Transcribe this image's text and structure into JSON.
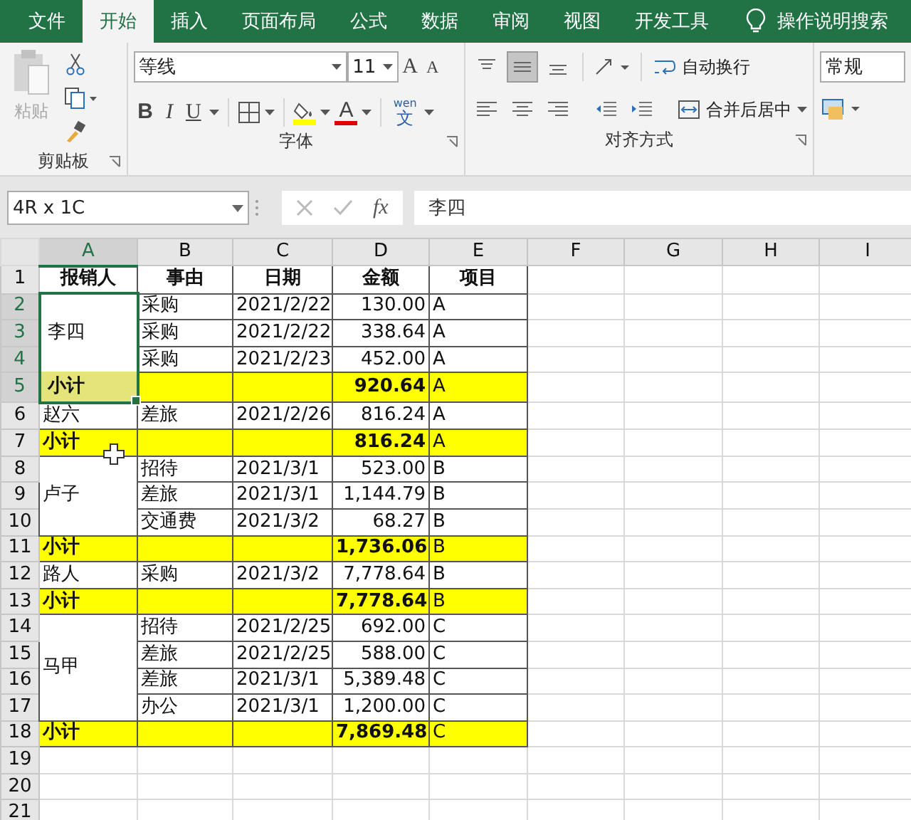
{
  "ribbon_tabs": [
    {
      "label": "文件",
      "selected": false
    },
    {
      "label": "开始",
      "selected": true
    },
    {
      "label": "插入",
      "selected": false
    },
    {
      "label": "页面布局",
      "selected": false
    },
    {
      "label": "公式",
      "selected": false
    },
    {
      "label": "数据",
      "selected": false
    },
    {
      "label": "审阅",
      "selected": false
    },
    {
      "label": "视图",
      "selected": false
    },
    {
      "label": "开发工具",
      "selected": false
    }
  ],
  "tell_me": "操作说明搜索",
  "clipboard": {
    "paste_label": "粘贴",
    "paste_disabled": true,
    "group_label": "剪贴板"
  },
  "font": {
    "name": "等线",
    "size": "11",
    "grow_label": "A",
    "shrink_label": "A",
    "styles": [
      "B",
      "I",
      "U"
    ],
    "font_color_label": "A",
    "phonetic_top": "wen",
    "phonetic_bottom": "文",
    "group_label": "字体"
  },
  "alignment": {
    "vertical": [
      {
        "kind": "top",
        "selected": false
      },
      {
        "kind": "middle",
        "selected": true
      },
      {
        "kind": "bottom",
        "selected": false
      }
    ],
    "horizontal": [
      {
        "kind": "left",
        "selected": false
      },
      {
        "kind": "center",
        "selected": false
      },
      {
        "kind": "right",
        "selected": false
      }
    ],
    "wrap_label": "自动换行",
    "merge_label": "合并后居中",
    "group_label": "对齐方式"
  },
  "number": {
    "format": "常规"
  },
  "formula_bar": {
    "name_box": "4R x 1C",
    "cancel_disabled": true,
    "enter_disabled": true,
    "fx_label": "fx",
    "value": "李四"
  },
  "columns": [
    {
      "label": "A",
      "selected": true
    },
    {
      "label": "B",
      "selected": false
    },
    {
      "label": "C",
      "selected": false
    },
    {
      "label": "D",
      "selected": false
    },
    {
      "label": "E",
      "selected": false
    },
    {
      "label": "F",
      "selected": false
    },
    {
      "label": "G",
      "selected": false
    },
    {
      "label": "H",
      "selected": false
    },
    {
      "label": "I",
      "selected": false
    }
  ],
  "header_row": {
    "number": "1",
    "cells": [
      "报销人",
      "事由",
      "日期",
      "金额",
      "项目"
    ]
  },
  "blocks": [
    {
      "kind": "group",
      "person": "李四",
      "selected": true,
      "rows": [
        {
          "number": "2",
          "cells": [
            "采购",
            "2021/2/22",
            "130.00",
            "A"
          ]
        },
        {
          "number": "3",
          "cells": [
            "采购",
            "2021/2/22",
            "338.64",
            "A"
          ]
        },
        {
          "number": "4",
          "cells": [
            "采购",
            "2021/2/23",
            "452.00",
            "A"
          ]
        }
      ]
    },
    {
      "kind": "subtotal",
      "number": "5",
      "label": "小计",
      "amount": "920.64",
      "item": "A",
      "selected": true
    },
    {
      "kind": "group",
      "person": "赵六",
      "selected": false,
      "rows": [
        {
          "number": "6",
          "cells": [
            "差旅",
            "2021/2/26",
            "816.24",
            "A"
          ]
        }
      ]
    },
    {
      "kind": "subtotal",
      "number": "7",
      "label": "小计",
      "amount": "816.24",
      "item": "A",
      "selected": false
    },
    {
      "kind": "group",
      "person": "卢子",
      "selected": false,
      "rows": [
        {
          "number": "8",
          "cells": [
            "招待",
            "2021/3/1",
            "523.00",
            "B"
          ]
        },
        {
          "number": "9",
          "cells": [
            "差旅",
            "2021/3/1",
            "1,144.79",
            "B"
          ]
        },
        {
          "number": "10",
          "cells": [
            "交通费",
            "2021/3/2",
            "68.27",
            "B"
          ]
        }
      ]
    },
    {
      "kind": "subtotal",
      "number": "11",
      "label": "小计",
      "amount": "1,736.06",
      "item": "B",
      "selected": false
    },
    {
      "kind": "group",
      "person": "路人",
      "selected": false,
      "rows": [
        {
          "number": "12",
          "cells": [
            "采购",
            "2021/3/2",
            "7,778.64",
            "B"
          ]
        }
      ]
    },
    {
      "kind": "subtotal",
      "number": "13",
      "label": "小计",
      "amount": "7,778.64",
      "item": "B",
      "selected": false
    },
    {
      "kind": "group",
      "person": "马甲",
      "selected": false,
      "rows": [
        {
          "number": "14",
          "cells": [
            "招待",
            "2021/2/25",
            "692.00",
            "C"
          ]
        },
        {
          "number": "15",
          "cells": [
            "差旅",
            "2021/2/25",
            "588.00",
            "C"
          ]
        },
        {
          "number": "16",
          "cells": [
            "差旅",
            "2021/3/1",
            "5,389.48",
            "C"
          ]
        },
        {
          "number": "17",
          "cells": [
            "办公",
            "2021/3/1",
            "1,200.00",
            "C"
          ]
        }
      ]
    },
    {
      "kind": "subtotal",
      "number": "18",
      "label": "小计",
      "amount": "7,869.48",
      "item": "C",
      "selected": false
    }
  ],
  "empty_rows": [
    "19",
    "20",
    "21"
  ]
}
